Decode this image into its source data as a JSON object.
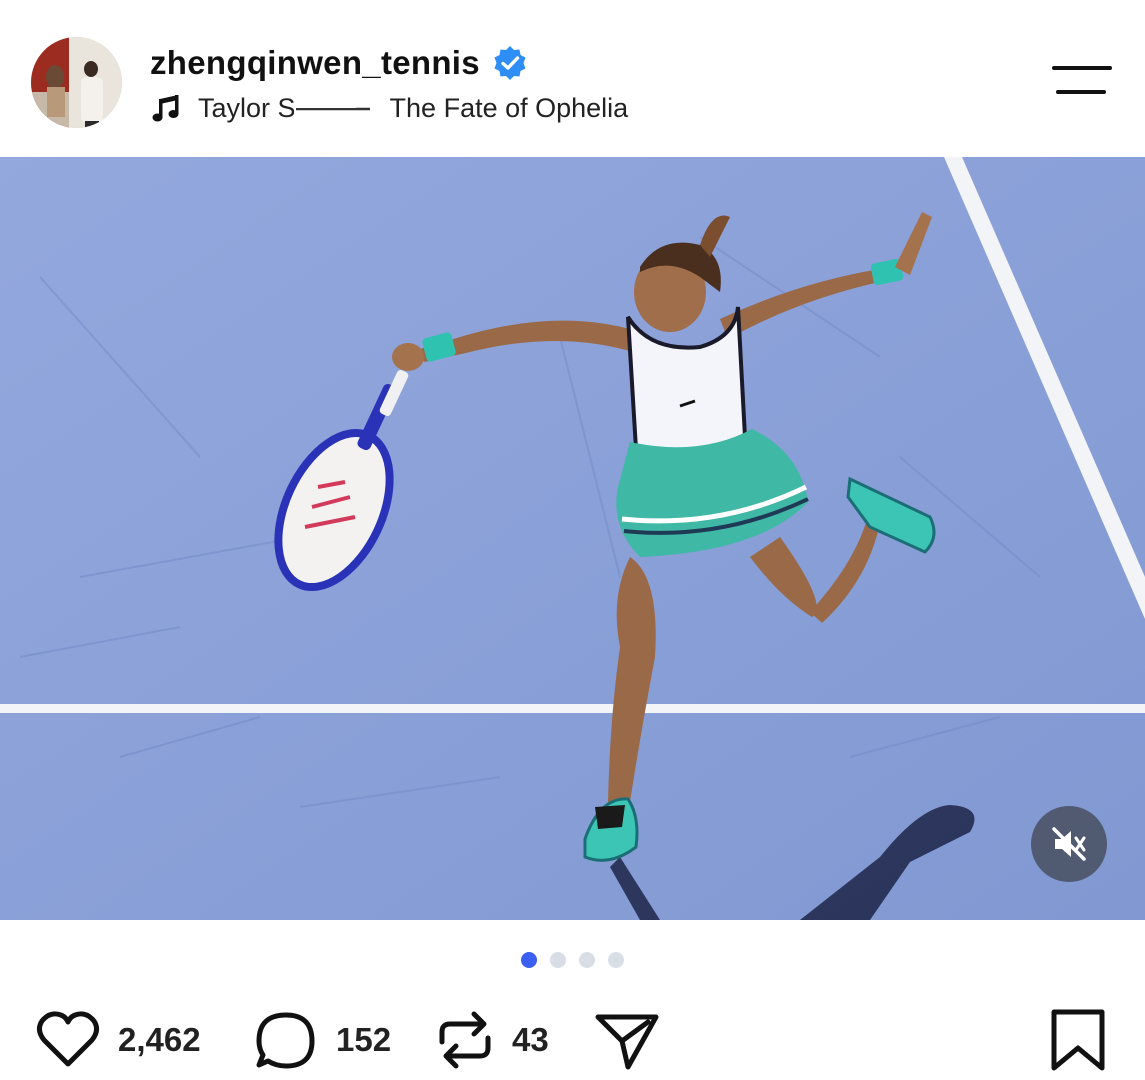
{
  "post": {
    "username": "zhengqinwen_tennis",
    "verified": true,
    "music": {
      "artist": "Taylor S",
      "separator": "-",
      "song": "The Fate of Ophelia"
    }
  },
  "media": {
    "description_alt": "photo",
    "carousel": {
      "count": 4,
      "active_index": 0
    },
    "muted": true
  },
  "actions": {
    "likes": "2,462",
    "comments": "152",
    "reposts": "43"
  },
  "icons": [
    "verified-badge-icon",
    "music-note-icon",
    "menu-icon",
    "muted-speaker-icon",
    "heart-icon",
    "comment-icon",
    "repost-icon",
    "share-icon",
    "bookmark-icon"
  ],
  "colors": {
    "accent": "#3b5ff0",
    "verified": "#2f8ef5",
    "court": "#8ea3d8",
    "dot_inactive": "#d9dde6"
  }
}
